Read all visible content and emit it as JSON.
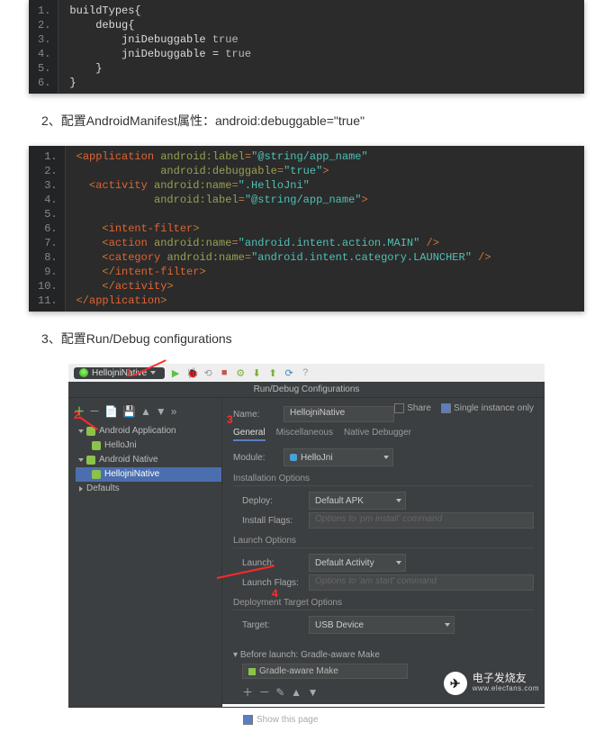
{
  "code1": {
    "lines": [
      "1.",
      "2.",
      "3.",
      "4.",
      "5.",
      "6."
    ],
    "text": {
      "l1": "buildTypes{",
      "l2": "    debug{",
      "l3a": "        jniDebuggable ",
      "l3b": "true",
      "l4a": "        jniDebuggable = ",
      "l4b": "true",
      "l5": "    }",
      "l6": "}"
    }
  },
  "para2": "2、配置AndroidManifest属性：android:debuggable=\"true\"",
  "code2": {
    "lines": [
      "1.",
      "2.",
      "3.",
      "4.",
      "5.",
      "6.",
      "7.",
      "8.",
      "9.",
      "10.",
      "11."
    ],
    "c": {
      "application": "application",
      "activity": "activity",
      "intent_filter": "intent-filter",
      "action": "action",
      "category": "category",
      "close_activity": "activity",
      "close_application": "application",
      "android_label": "android:label",
      "android_debuggable": "android:debuggable",
      "android_name": "android:name",
      "val_app_name": "\"@string/app_name\"",
      "val_true": "\"true\"",
      "val_hellojni": "\".HelloJni\"",
      "val_main": "\"android.intent.action.MAIN\"",
      "val_launcher": "\"android.intent.category.LAUNCHER\""
    }
  },
  "para3": "3、配置Run/Debug configurations",
  "ide": {
    "config_selector": "HellojniNative",
    "dialog_title": "Run/Debug Configurations",
    "name_label": "Name:",
    "name_value": "HellojniNative",
    "share": "Share",
    "single": "Single instance only",
    "tabs": {
      "general": "General",
      "misc": "Miscellaneous",
      "native": "Native Debugger"
    },
    "module_label": "Module:",
    "module_value": "HelloJni",
    "install_opts": "Installation Options",
    "deploy_label": "Deploy:",
    "deploy_value": "Default APK",
    "install_flags_label": "Install Flags:",
    "install_flags_ph": "Options to 'pm install' command",
    "launch_opts": "Launch Options",
    "launch_label": "Launch:",
    "launch_value": "Default Activity",
    "launch_flags_label": "Launch Flags:",
    "launch_flags_ph": "Options to 'am start' command",
    "deploy_target": "Deployment Target Options",
    "target_label": "Target:",
    "target_value": "USB Device",
    "before_launch": "Before launch: Gradle-aware Make",
    "gradle_make": "Gradle-aware Make",
    "show_page": "Show this page",
    "tree": {
      "android_app": "Android Application",
      "hellojni": "HelloJni",
      "android_native": "Android Native",
      "hellojni_native": "HellojniNative",
      "defaults": "Defaults"
    },
    "annotation": {
      "n1": "1",
      "n2": "2",
      "n3": "3",
      "n4": "4"
    },
    "wm_t1": "电子发烧友",
    "wm_t2": "www.elecfans.com"
  }
}
